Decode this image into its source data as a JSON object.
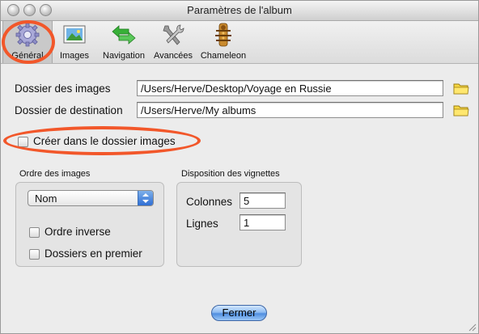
{
  "window": {
    "title": "Paramètres de l'album"
  },
  "toolbar": {
    "items": [
      {
        "label": "Général",
        "icon": "gear-icon",
        "selected": true
      },
      {
        "label": "Images",
        "icon": "picture-icon",
        "selected": false
      },
      {
        "label": "Navigation",
        "icon": "arrows-icon",
        "selected": false
      },
      {
        "label": "Avancées",
        "icon": "tools-icon",
        "selected": false
      },
      {
        "label": "Chameleon",
        "icon": "chameleon-icon",
        "selected": false
      }
    ]
  },
  "general": {
    "images_folder_label": "Dossier des images",
    "images_folder_value": "/Users/Herve/Desktop/Voyage en Russie",
    "dest_folder_label": "Dossier de destination",
    "dest_folder_value": "/Users/Herve/My albums",
    "create_in_images_label": "Créer dans le dossier images",
    "create_in_images_checked": false
  },
  "order": {
    "title": "Ordre des images",
    "selected": "Nom",
    "reverse_label": "Ordre inverse",
    "reverse_checked": false,
    "folders_first_label": "Dossiers en premier",
    "folders_first_checked": false
  },
  "thumbs": {
    "title": "Disposition des vignettes",
    "columns_label": "Colonnes",
    "columns_value": "5",
    "rows_label": "Lignes",
    "rows_value": "1"
  },
  "close_button": "Fermer",
  "colors": {
    "highlight_ellipse": "#f2572a",
    "accent": "#4f8ee0"
  }
}
